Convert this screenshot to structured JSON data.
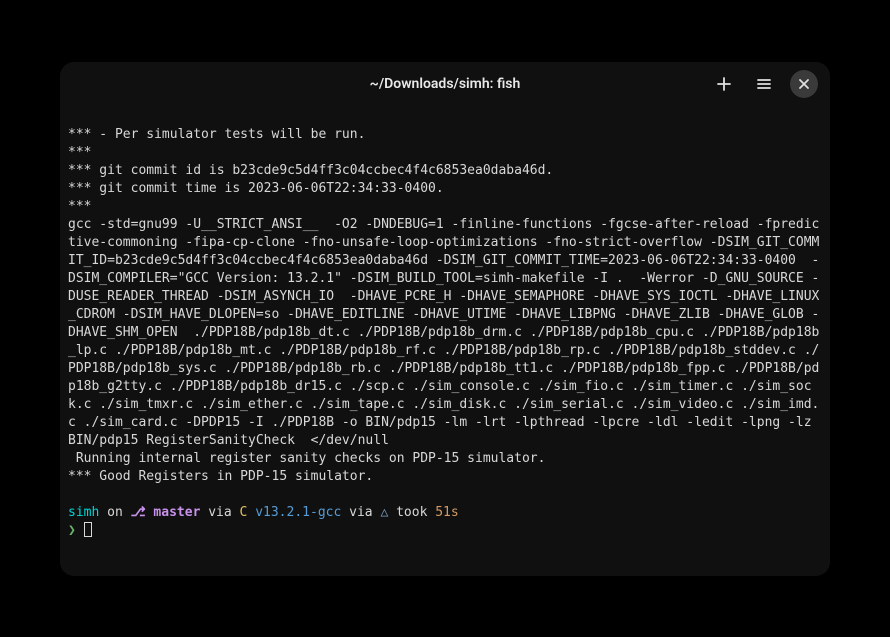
{
  "titlebar": {
    "title": "~/Downloads/simh: fish"
  },
  "output": {
    "l0": "*** - Per simulator tests will be run.",
    "l1": "***",
    "l2": "*** git commit id is b23cde9c5d4ff3c04ccbec4f4c6853ea0daba46d.",
    "l3": "*** git commit time is 2023-06-06T22:34:33-0400.",
    "l4": "***",
    "l5": "gcc -std=gnu99 -U__STRICT_ANSI__  -O2 -DNDEBUG=1 -finline-functions -fgcse-after-reload -fpredictive-commoning -fipa-cp-clone -fno-unsafe-loop-optimizations -fno-strict-overflow -DSIM_GIT_COMMIT_ID=b23cde9c5d4ff3c04ccbec4f4c6853ea0daba46d -DSIM_GIT_COMMIT_TIME=2023-06-06T22:34:33-0400  -DSIM_COMPILER=\"GCC Version: 13.2.1\" -DSIM_BUILD_TOOL=simh-makefile -I .  -Werror -D_GNU_SOURCE -DUSE_READER_THREAD -DSIM_ASYNCH_IO  -DHAVE_PCRE_H -DHAVE_SEMAPHORE -DHAVE_SYS_IOCTL -DHAVE_LINUX_CDROM -DSIM_HAVE_DLOPEN=so -DHAVE_EDITLINE -DHAVE_UTIME -DHAVE_LIBPNG -DHAVE_ZLIB -DHAVE_GLOB -DHAVE_SHM_OPEN  ./PDP18B/pdp18b_dt.c ./PDP18B/pdp18b_drm.c ./PDP18B/pdp18b_cpu.c ./PDP18B/pdp18b_lp.c ./PDP18B/pdp18b_mt.c ./PDP18B/pdp18b_rf.c ./PDP18B/pdp18b_rp.c ./PDP18B/pdp18b_stddev.c ./PDP18B/pdp18b_sys.c ./PDP18B/pdp18b_rb.c ./PDP18B/pdp18b_tt1.c ./PDP18B/pdp18b_fpp.c ./PDP18B/pdp18b_g2tty.c ./PDP18B/pdp18b_dr15.c ./scp.c ./sim_console.c ./sim_fio.c ./sim_timer.c ./sim_sock.c ./sim_tmxr.c ./sim_ether.c ./sim_tape.c ./sim_disk.c ./sim_serial.c ./sim_video.c ./sim_imd.c ./sim_card.c -DPDP15 -I ./PDP18B -o BIN/pdp15 -lm -lrt -lpthread -lpcre -ldl -ledit -lpng -lz",
    "l6": "BIN/pdp15 RegisterSanityCheck  </dev/null",
    "l7": " Running internal register sanity checks on PDP-15 simulator.",
    "l8": "*** Good Registers in PDP-15 simulator."
  },
  "prompt": {
    "dir": "simh",
    "on": " on ",
    "branch_icon": "⎇",
    "branch": " master",
    "via1": " via ",
    "lang": "C ",
    "ver": "v13.2.1-gcc",
    "via2": " via ",
    "triangle": "△",
    "took": " took ",
    "time": "51s",
    "caret": "❯"
  }
}
